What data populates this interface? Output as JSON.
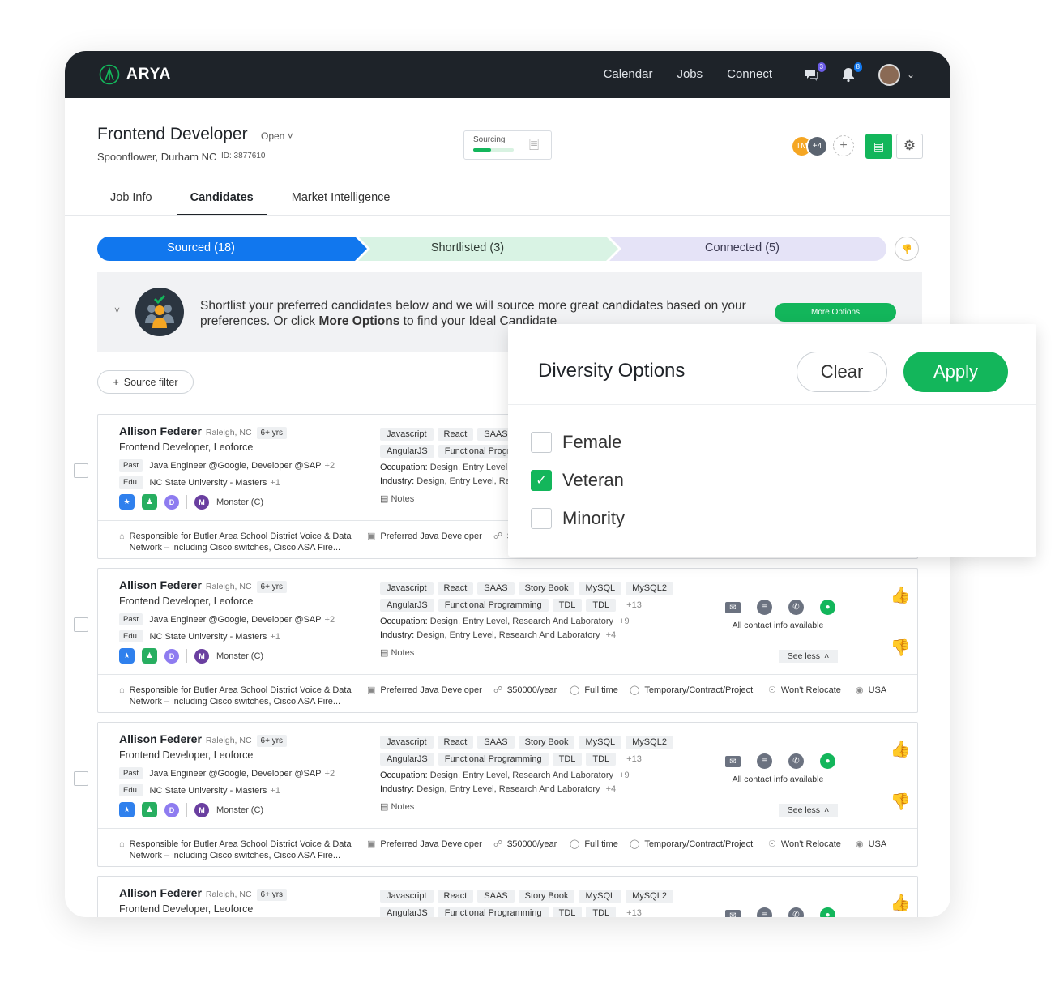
{
  "app": {
    "name": "ARYA"
  },
  "nav": {
    "calendar": "Calendar",
    "jobs": "Jobs",
    "connect": "Connect",
    "chat_badge": "3",
    "notif_badge": "8"
  },
  "job": {
    "title": "Frontend Developer",
    "status": "Open",
    "location": "Spoonflower, Durham NC",
    "id": "ID: 3877610",
    "sourcing_label": "Sourcing",
    "sourcing_progress": 0.44
  },
  "team": {
    "initials": "TM",
    "more": "+4"
  },
  "tabs": [
    "Job Info",
    "Candidates",
    "Market Intelligence"
  ],
  "pipeline": {
    "sourced": "Sourced (18)",
    "shortlisted": "Shortlisted (3)",
    "connected": "Connected (5)"
  },
  "banner": {
    "text_a": "Shortlist your preferred candidates below and we will source more great candidates based on your preferences. Or click ",
    "text_bold": "More Options",
    "text_b": " to find your Ideal Candidate",
    "button": "More Options"
  },
  "source_filter": "Source filter",
  "candidate": {
    "name": "Allison Federer",
    "location": "Raleigh, NC",
    "experience": "6+ yrs",
    "role": "Frontend Developer, Leoforce",
    "past_tag": "Past",
    "past": "Java Engineer @Google, Developer @SAP",
    "past_more": "+2",
    "edu_tag": "Edu.",
    "edu": "NC State University - Masters",
    "edu_more": "+1",
    "source": "Monster (C)",
    "skills_row1": [
      "Javascript",
      "React",
      "SAAS",
      "Story Book",
      "MySQL",
      "MySQL2"
    ],
    "skills_row2": [
      "AngularJS",
      "Functional Programming",
      "TDL",
      "TDL"
    ],
    "skills_more": "+13",
    "occupation_label": "Occupation:",
    "occupation": "Design, Entry Level, Research And Laboratory",
    "occupation_more": "+9",
    "industry_label": "Industry:",
    "industry": "Design, Entry Level, Research And Laboratory",
    "industry_more": "+4",
    "notes": "Notes",
    "contact_text": "All contact info available",
    "see_less": "See less",
    "summary": "Responsible for Butler Area School District Voice & Data Network – including Cisco switches, Cisco ASA Fire...",
    "preferred": "Preferred Java Developer",
    "salary": "$50000/year",
    "job_type": "Full time",
    "contract": "Temporary/Contract/Project",
    "relocate": "Won't Relocate",
    "country": "USA"
  },
  "diversity": {
    "title": "Diversity Options",
    "clear": "Clear",
    "apply": "Apply",
    "options": [
      {
        "label": "Female",
        "checked": false
      },
      {
        "label": "Veteran",
        "checked": true
      },
      {
        "label": "Minority",
        "checked": false
      }
    ]
  },
  "colors": {
    "topbar": "#1e2329",
    "accent": "#13b65b",
    "sourced": "#1177ee",
    "shortlisted": "#d9f3e4",
    "connected": "#e5e3f7"
  }
}
